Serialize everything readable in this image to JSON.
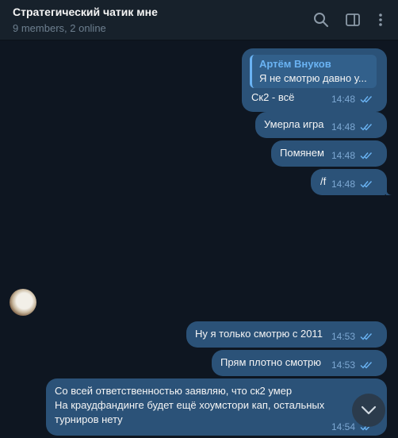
{
  "header": {
    "title": "Стратегический чатик мне",
    "subtitle": "9 members, 2 online",
    "icons": [
      "search-icon",
      "sidebar-toggle-icon",
      "more-vertical-icon"
    ]
  },
  "messages": [
    {
      "reply_author": "Артём Внуков",
      "reply_preview": "Я не смотрю давно у...",
      "text": "Ск2 - всё",
      "time": "14:48",
      "status": "read"
    },
    {
      "text": "Умерла игра",
      "time": "14:48",
      "status": "read"
    },
    {
      "text": "Помянем",
      "time": "14:48",
      "status": "read"
    },
    {
      "text": "/f",
      "time": "14:48",
      "status": "read"
    },
    {
      "text": "Ну я только смотрю с 2011",
      "time": "14:53",
      "status": "read"
    },
    {
      "text": "Прям плотно смотрю",
      "time": "14:53",
      "status": "read"
    },
    {
      "lines": [
        "Со всей ответственностью заявляю, что ск2 умер",
        "На краудфандинге будет ещё хоумстори кап, остальных",
        "турниров нету"
      ],
      "time": "14:54",
      "status": "read"
    }
  ],
  "colors": {
    "background": "#0e1621",
    "header": "#17212b",
    "outgoing_bubble": "#2b5278",
    "accent": "#6ab3f3",
    "meta": "#7da8d3"
  }
}
